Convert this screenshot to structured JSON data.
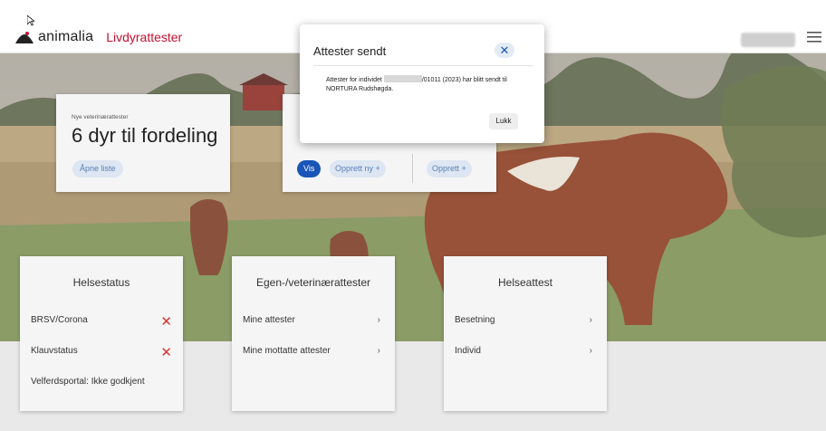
{
  "header": {
    "brand": "animalia",
    "product": "Livdyrattester"
  },
  "card_dyr": {
    "small_label": "Nye veterinærattester",
    "heading": "6 dyr til fordeling",
    "button": "Åpne liste"
  },
  "card_mid": {
    "vis": "Vis",
    "opprett_ny": "Opprett ny +",
    "opprett": "Opprett +"
  },
  "helsestatus": {
    "title": "Helsestatus",
    "rows": [
      "BRSV/Corona",
      "Klauvstatus",
      "Velferdsportal: Ikke godkjent"
    ]
  },
  "egen": {
    "title": "Egen-/veterinærattester",
    "rows": [
      "Mine attester",
      "Mine mottatte attester"
    ]
  },
  "helseattest": {
    "title": "Helseattest",
    "rows": [
      "Besetning",
      "Individ"
    ]
  },
  "modal": {
    "title": "Attester sendt",
    "close": "✕",
    "body_before": "Attester for individet",
    "body_after": "/01011 (2023) har blitt sendt til NORTURA Rudshøgda.",
    "button": "Lukk"
  },
  "colors": {
    "accent": "#c8102e",
    "primary": "#1a55b8",
    "error": "#d33333"
  }
}
